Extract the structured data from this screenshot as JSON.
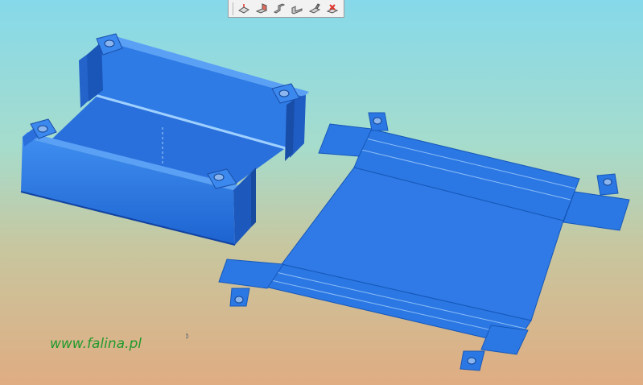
{
  "toolbar": {
    "tools": [
      {
        "name": "base-flange-icon"
      },
      {
        "name": "edge-flange-icon"
      },
      {
        "name": "hem-icon"
      },
      {
        "name": "jog-icon"
      },
      {
        "name": "sketched-bend-icon"
      },
      {
        "name": "flatten-icon"
      }
    ]
  },
  "watermark": {
    "text": "www.falina.pl"
  },
  "colors": {
    "part": "#2b78e4",
    "part_shadow": "#1552b0",
    "part_light": "#4c93f0",
    "bend_line": "#7fb4f5",
    "watermark": "#1f9a2a"
  }
}
